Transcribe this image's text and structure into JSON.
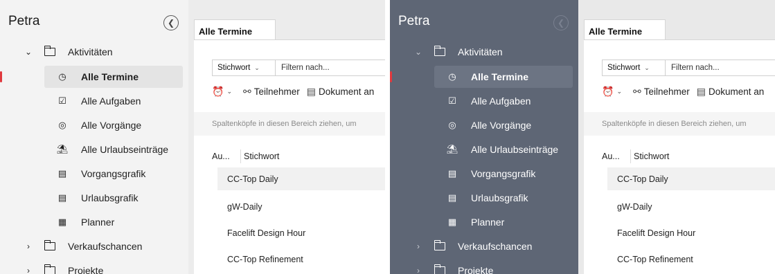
{
  "app": {
    "title": "Petra"
  },
  "sidebar": {
    "groups": [
      {
        "label": "Aktivitäten",
        "expanded": true
      },
      {
        "label": "Verkaufschancen",
        "expanded": false
      },
      {
        "label": "Projekte",
        "expanded": false
      }
    ],
    "items": [
      {
        "label": "Alle Termine",
        "icon": "clock-icon",
        "selected": true
      },
      {
        "label": "Alle Aufgaben",
        "icon": "checklist-icon",
        "selected": false
      },
      {
        "label": "Alle Vorgänge",
        "icon": "process-icon",
        "selected": false
      },
      {
        "label": "Alle Urlaubseinträge",
        "icon": "vacation-icon",
        "selected": false
      },
      {
        "label": "Vorgangsgrafik",
        "icon": "gantt-icon",
        "selected": false
      },
      {
        "label": "Urlaubsgrafik",
        "icon": "gantt-icon",
        "selected": false
      },
      {
        "label": "Planner",
        "icon": "planner-icon",
        "selected": false
      }
    ]
  },
  "main": {
    "tab_label": "Alle Termine",
    "filter": {
      "field": "Stichwort",
      "placeholder": "Filtern nach..."
    },
    "toolbar": {
      "participants": "Teilnehmer",
      "document": "Dokument an"
    },
    "group_hint": "Spaltenköpfe in diesen Bereich ziehen, um",
    "columns": [
      "Au...",
      "Stichwort"
    ],
    "rows": [
      "CC-Top Daily",
      "gW-Daily",
      "Facelift Design Hour",
      "CC-Top Refinement"
    ]
  },
  "colors": {
    "accent": "#e0393e",
    "sidebar_light": "#f3f3f3",
    "sidebar_dark": "#5e6675"
  }
}
